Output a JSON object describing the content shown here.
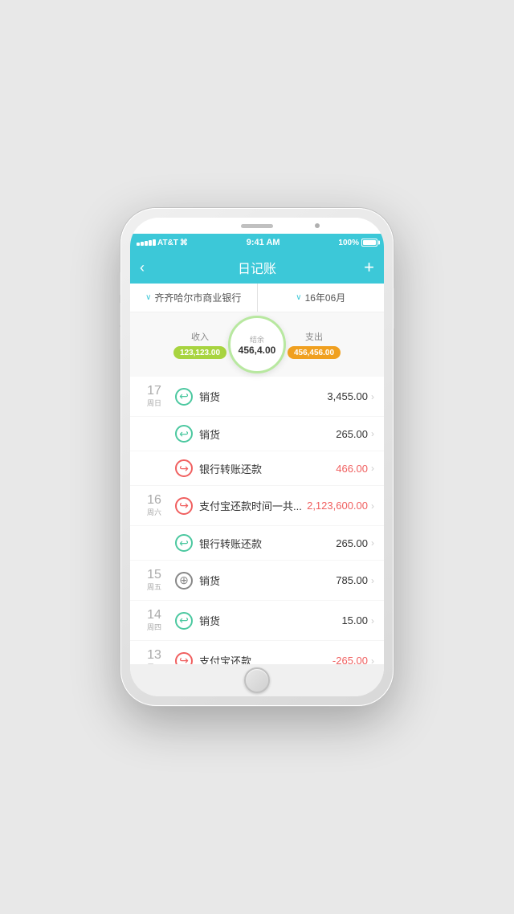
{
  "status_bar": {
    "carrier": "AT&T",
    "wifi": "WiFi",
    "time": "9:41 AM",
    "battery": "100%"
  },
  "nav": {
    "back_label": "‹",
    "title": "日记账",
    "add_label": "+"
  },
  "filter": {
    "bank": "齐齐哈尔市商业银行",
    "period": "16年06月",
    "chevron": "∨"
  },
  "summary": {
    "income_label": "收入",
    "income_value": "123,123.00",
    "balance_label": "结余",
    "balance_value": "456,4.00",
    "expense_label": "支出",
    "expense_value": "456,456.00"
  },
  "transactions": [
    {
      "day_num": "17",
      "day_week": "周日",
      "icon_type": "income",
      "name": "销货",
      "amount": "3,455.00",
      "amount_red": false
    },
    {
      "day_num": "",
      "day_week": "",
      "icon_type": "income",
      "name": "销货",
      "amount": "265.00",
      "amount_red": false
    },
    {
      "day_num": "",
      "day_week": "",
      "icon_type": "expense",
      "name": "银行转账还款",
      "amount": "466.00",
      "amount_red": true
    },
    {
      "day_num": "16",
      "day_week": "周六",
      "icon_type": "expense",
      "name": "支付宝还款时间一共...",
      "amount": "2,123,600.00",
      "amount_red": true
    },
    {
      "day_num": "",
      "day_week": "",
      "icon_type": "income",
      "name": "银行转账还款",
      "amount": "265.00",
      "amount_red": false
    },
    {
      "day_num": "15",
      "day_week": "周五",
      "icon_type": "special",
      "name": "销货",
      "amount": "785.00",
      "amount_red": false
    },
    {
      "day_num": "14",
      "day_week": "周四",
      "icon_type": "income",
      "name": "销货",
      "amount": "15.00",
      "amount_red": false
    },
    {
      "day_num": "13",
      "day_week": "周三",
      "icon_type": "expense",
      "name": "支付宝还款",
      "amount": "-265.00",
      "amount_red": true
    }
  ]
}
